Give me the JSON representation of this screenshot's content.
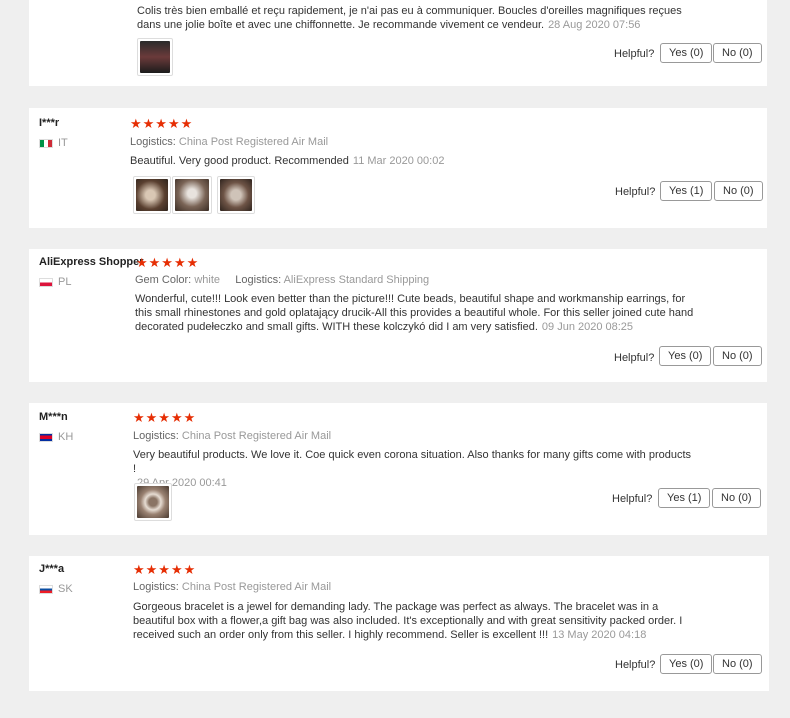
{
  "helpful_label": "Helpful?",
  "reviews": [
    {
      "text": "Colis très bien emballé et reçu rapidement, je n'ai pas eu à communiquer. Boucles d'oreilles magnifiques reçues dans une jolie boîte et avec une chiffonnette. Je recommande vivement ce vendeur.",
      "date": "28 Aug 2020 07:56",
      "yes": "Yes (0)",
      "no": "No (0)"
    },
    {
      "user": "I***r",
      "country": "IT",
      "stars": "★★★★★",
      "logistics_label": "Logistics:",
      "logistics": "China Post Registered Air Mail",
      "text": "Beautiful. Very good product. Recommended",
      "date": "11 Mar 2020 00:02",
      "yes": "Yes (1)",
      "no": "No (0)"
    },
    {
      "user": "AliExpress Shopper",
      "country": "PL",
      "stars": "★★★★★",
      "gem_label": "Gem Color:",
      "gem": "white",
      "logistics_label": "Logistics:",
      "logistics": "AliExpress Standard Shipping",
      "text": "Wonderful, cute!!! Look even better than the picture!!! Cute beads, beautiful shape and workmanship earrings, for this small rhinestones and gold oplatający drucik-All this provides a beautiful whole. For this seller joined cute hand decorated pudełeczko and small gifts. WITH these kolczykó did I am very satisfied.",
      "date": "09 Jun 2020 08:25",
      "yes": "Yes (0)",
      "no": "No (0)"
    },
    {
      "user": "M***n",
      "country": "KH",
      "stars": "★★★★★",
      "logistics_label": "Logistics:",
      "logistics": "China Post Registered Air Mail",
      "text": "Very beautiful products. We love it. Coe quick even corona situation. Also thanks for many gifts come with products !",
      "date": "29 Apr 2020 00:41",
      "yes": "Yes (1)",
      "no": "No (0)"
    },
    {
      "user": "J***a",
      "country": "SK",
      "stars": "★★★★★",
      "logistics_label": "Logistics:",
      "logistics": "China Post Registered Air Mail",
      "text": "Gorgeous bracelet is a jewel for demanding lady. The package was perfect as always. The bracelet was in a beautiful box with a flower,a gift bag was also included. It's exceptionally and with great sensitivity packed order. I received such an order only from this seller. I highly recommend. Seller is excellent !!!",
      "date": "13 May 2020 04:18",
      "yes": "Yes (0)",
      "no": "No (0)"
    }
  ]
}
